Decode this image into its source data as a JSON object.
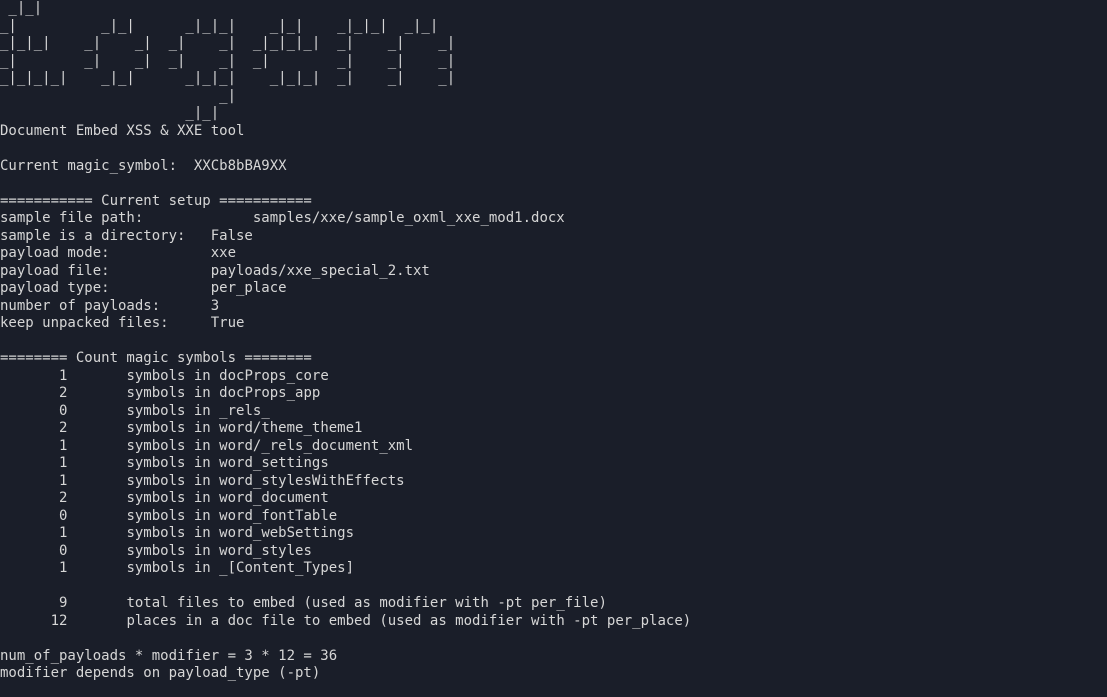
{
  "ascii_art": " _|_|                                      \n_|          _|_|      _|_|_|    _|_|    _|_|_|  _|_|  \n_|_|_|    _|    _|  _|    _|  _|_|_|_|  _|    _|    _|\n_|        _|    _|  _|    _|  _|        _|    _|    _|\n_|_|_|_|    _|_|      _|_|_|    _|_|_|  _|    _|    _|\n                          _|                          \n                      _|_|                            ",
  "subtitle": "Document Embed XSS & XXE tool",
  "magic_label": "Current magic_symbol:  ",
  "magic_value": "XXCb8bBA9XX",
  "setup_header": "=========== Current setup ===========",
  "setup": [
    {
      "label": "sample file path:",
      "pad": 30,
      "value": "samples/xxe/sample_oxml_xxe_mod1.docx"
    },
    {
      "label": "sample is a directory:",
      "pad": 25,
      "value": "False"
    },
    {
      "label": "payload mode:",
      "pad": 25,
      "value": "xxe"
    },
    {
      "label": "payload file:",
      "pad": 25,
      "value": "payloads/xxe_special_2.txt"
    },
    {
      "label": "payload type:",
      "pad": 25,
      "value": "per_place"
    },
    {
      "label": "number of payloads:",
      "pad": 25,
      "value": "3"
    },
    {
      "label": "keep unpacked files:",
      "pad": 25,
      "value": "True"
    }
  ],
  "count_header": "======== Count magic symbols ========",
  "count_rows": [
    {
      "n": "1",
      "text": "symbols in docProps_core"
    },
    {
      "n": "2",
      "text": "symbols in docProps_app"
    },
    {
      "n": "0",
      "text": "symbols in _rels_"
    },
    {
      "n": "2",
      "text": "symbols in word/theme_theme1"
    },
    {
      "n": "1",
      "text": "symbols in word/_rels_document_xml"
    },
    {
      "n": "1",
      "text": "symbols in word_settings"
    },
    {
      "n": "1",
      "text": "symbols in word_stylesWithEffects"
    },
    {
      "n": "2",
      "text": "symbols in word_document"
    },
    {
      "n": "0",
      "text": "symbols in word_fontTable"
    },
    {
      "n": "1",
      "text": "symbols in word_webSettings"
    },
    {
      "n": "0",
      "text": "symbols in word_styles"
    },
    {
      "n": "1",
      "text": "symbols in _[Content_Types]"
    }
  ],
  "totals": [
    {
      "n": "9",
      "text": "total files to embed (used as modifier with -pt per_file)"
    },
    {
      "n": "12",
      "text": "places in a doc file to embed (used as modifier with -pt per_place)"
    }
  ],
  "footer": {
    "eq": "num_of_payloads * modifier = 3 * 12 = 36",
    "note": "modifier depends on payload_type (-pt)"
  }
}
